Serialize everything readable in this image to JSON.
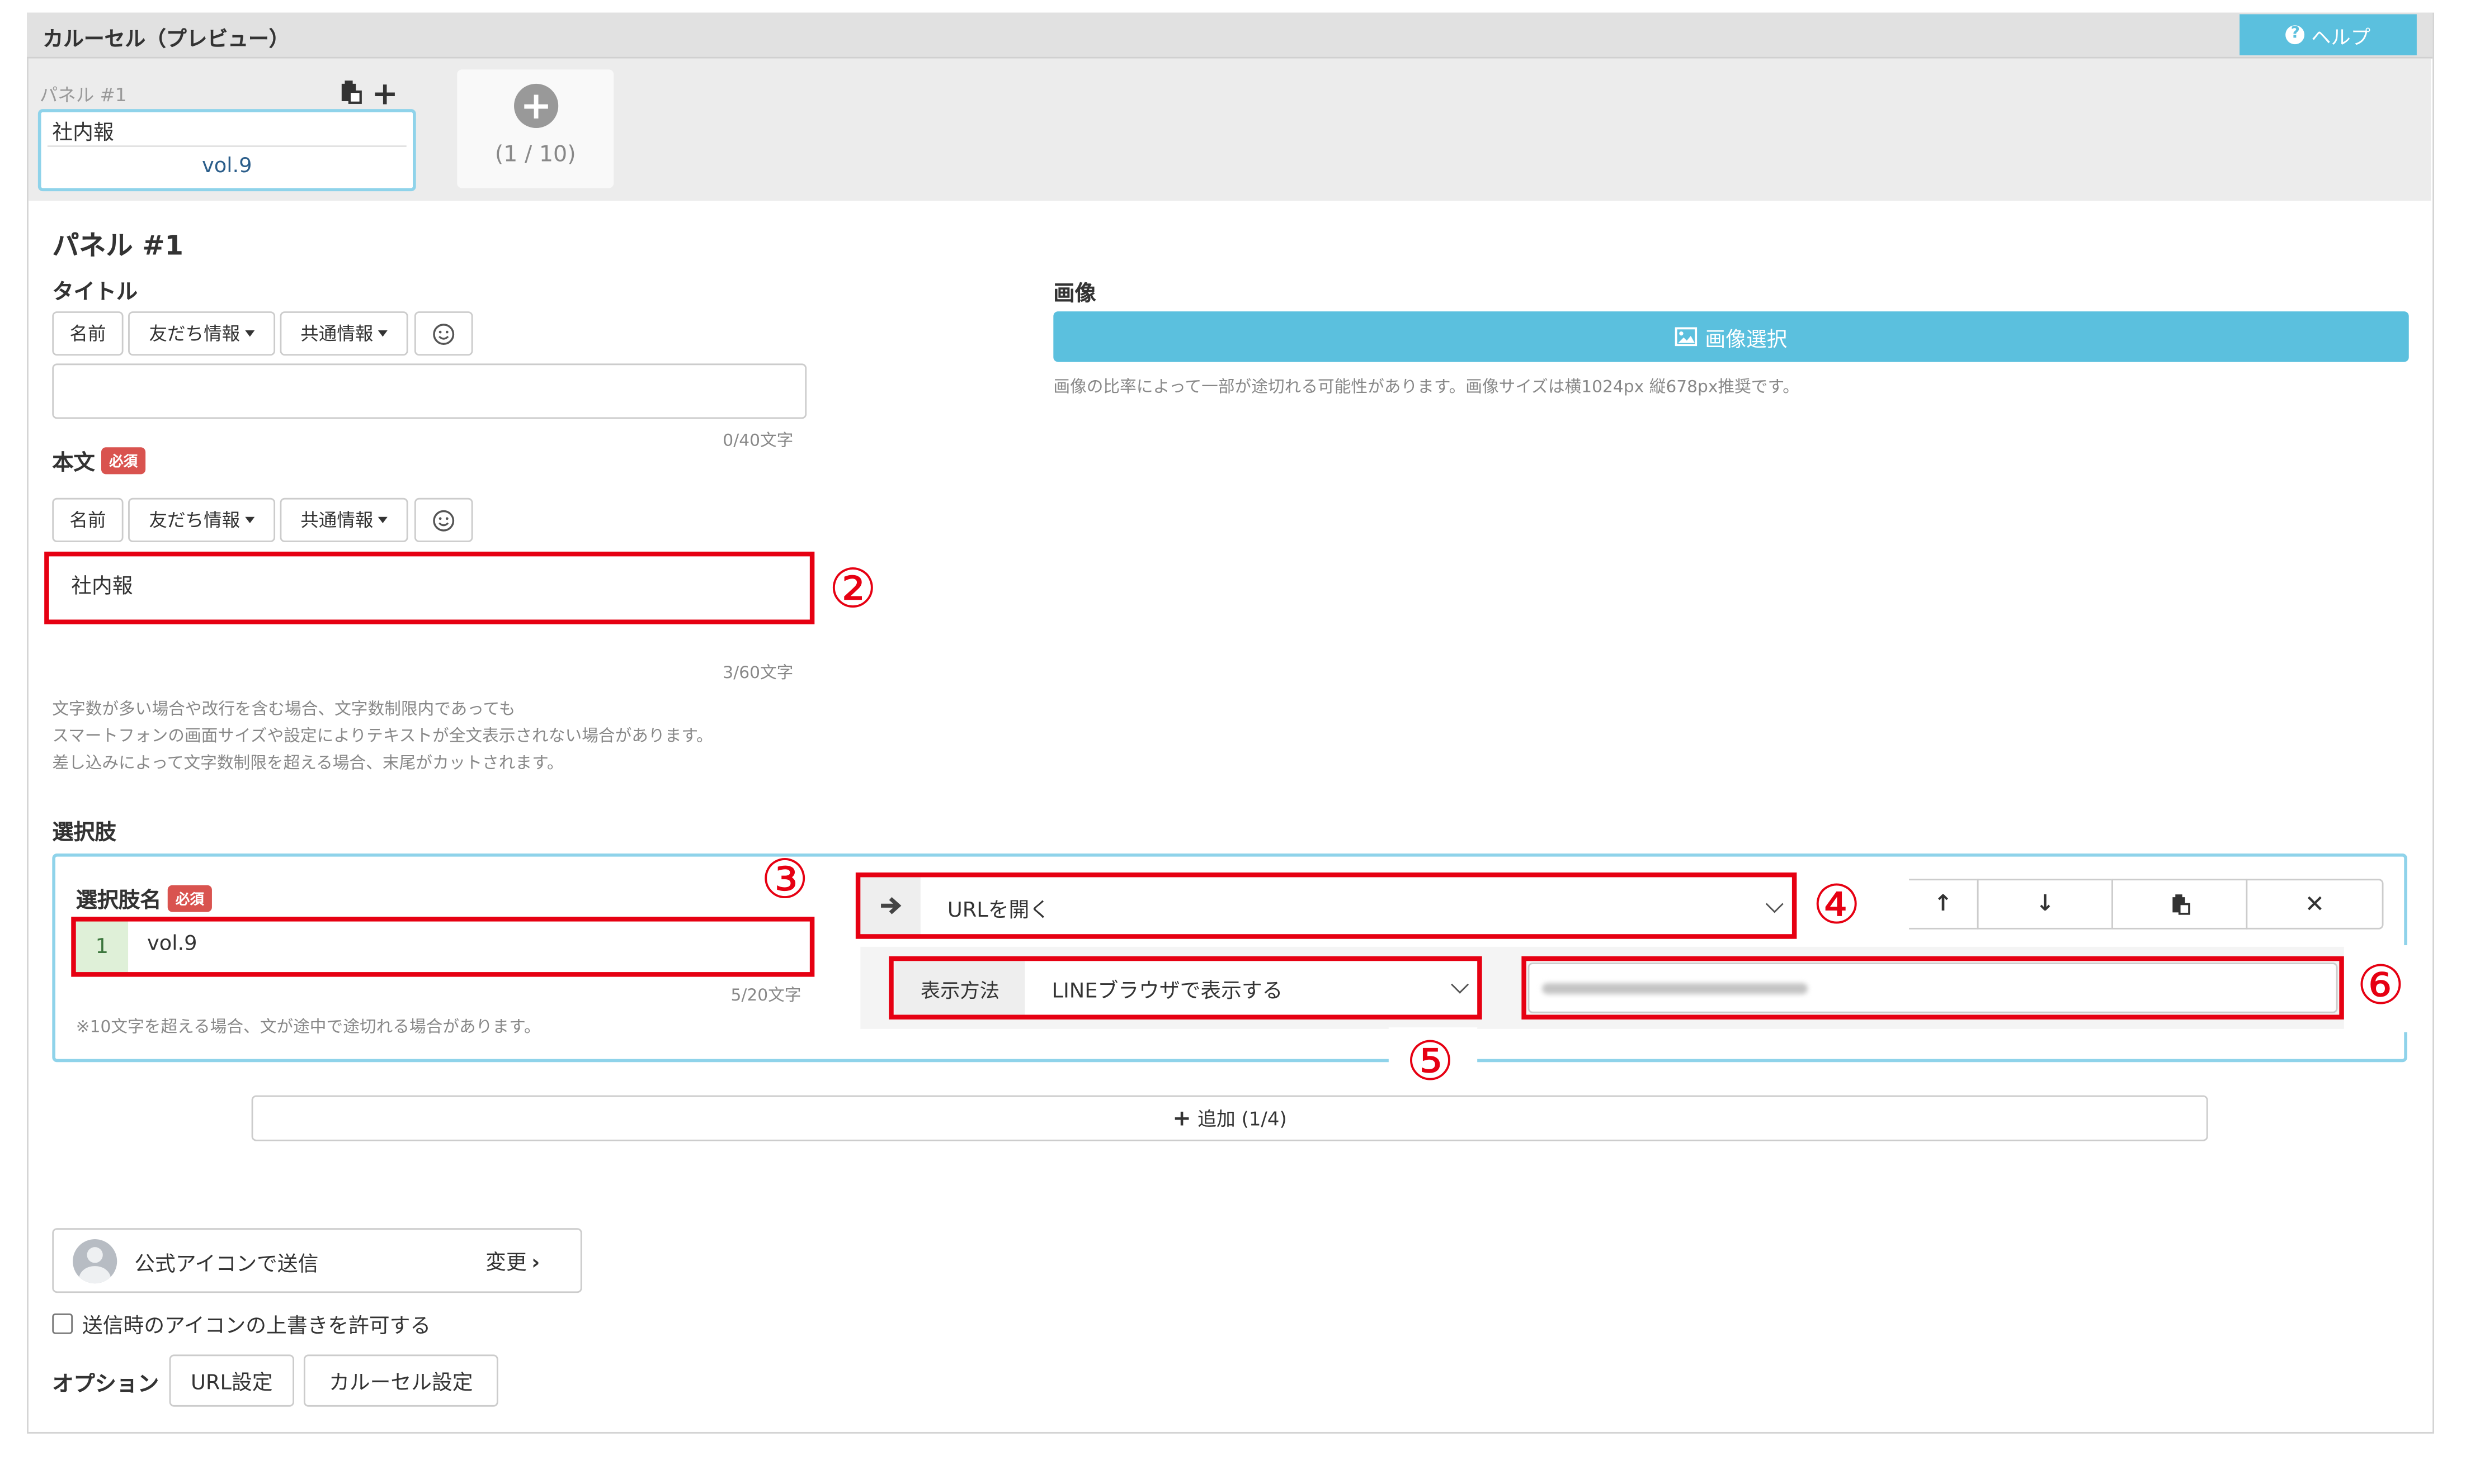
{
  "header": {
    "title": "カルーセル（プレビュー）",
    "help_label": "ヘルプ"
  },
  "panel_tabs": [
    {
      "label": "パネル #1",
      "title": "社内報",
      "choice": "vol.9"
    }
  ],
  "add_panel": {
    "counter": "(1 / 10)"
  },
  "panel": {
    "heading": "パネル #1",
    "title": {
      "label": "タイトル",
      "counter": "0/40文字",
      "value": ""
    },
    "insert_buttons": {
      "name": "名前",
      "friend_info": "友だち情報",
      "common_info": "共通情報"
    },
    "body": {
      "label": "本文",
      "required": "必須",
      "value": "社内報",
      "counter": "3/60文字",
      "notes": [
        "文字数が多い場合や改行を含む場合、文字数制限内であっても",
        "スマートフォンの画面サイズや設定によりテキストが全文表示されない場合があります。",
        "差し込みによって文字数制限を超える場合、末尾がカットされます。"
      ]
    },
    "image": {
      "label": "画像",
      "button": "画像選択",
      "note": "画像の比率によって一部が途切れる可能性があります。画像サイズは横1024px 縦678px推奨です。"
    }
  },
  "choices": {
    "label": "選択肢",
    "item": {
      "name_label": "選択肢名",
      "required": "必須",
      "index": "1",
      "value": "vol.9",
      "counter": "5/20文字",
      "note": "※10文字を超える場合、文が途中で途切れる場合があります。",
      "action": "URLを開く",
      "display_label": "表示方法",
      "display_value": "LINEブラウザで表示する",
      "url_value": ""
    },
    "add_button": "追加 (1/4)"
  },
  "sender": {
    "label": "公式アイコンで送信",
    "change": "変更"
  },
  "override": {
    "label": "送信時のアイコンの上書きを許可する",
    "checked": false
  },
  "options": {
    "label": "オプション",
    "url_button": "URL設定",
    "carousel_button": "カルーセル設定"
  },
  "annotations": {
    "n2": "②",
    "n3": "③",
    "n4": "④",
    "n5": "⑤",
    "n6": "⑥"
  },
  "colors": {
    "accent": "#5bc0de",
    "required": "#d9534f",
    "annotation": "#e60012"
  }
}
